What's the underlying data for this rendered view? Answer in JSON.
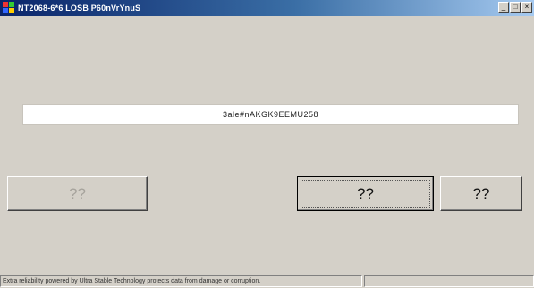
{
  "window": {
    "title": "NT2068-6*6 LOSB P60nVrYnuS",
    "controls": {
      "minimize": "_",
      "maximize": "□",
      "close": "×"
    }
  },
  "serial": {
    "value": "3ale#nAKGK9EEMU258"
  },
  "buttons": {
    "left": {
      "label": "??",
      "enabled": false
    },
    "middle": {
      "label": "??",
      "enabled": true,
      "focused": true
    },
    "right": {
      "label": "??",
      "enabled": true
    }
  },
  "status": {
    "text": "Extra reliability powered by Ultra Stable Technology protects data from damage or corruption.",
    "secondary": ""
  },
  "colors": {
    "face": "#d4d0c8",
    "titlebar_start": "#0a246a",
    "titlebar_end": "#a6caf0",
    "disabled_text": "#a6a39c"
  },
  "icons": {
    "app": "app-icon"
  }
}
